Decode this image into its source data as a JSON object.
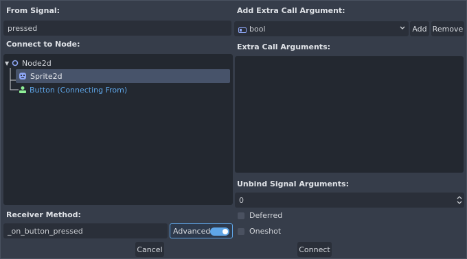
{
  "from_signal": {
    "label": "From Signal:",
    "value": "pressed"
  },
  "connect_to_node": {
    "label": "Connect to Node:",
    "tree": [
      {
        "label": "Node2d",
        "icon": "node2d-icon"
      },
      {
        "label": "Sprite2d",
        "icon": "sprite2d-icon",
        "selected": true
      },
      {
        "label": "Button (Connecting From)",
        "icon": "button-node-icon",
        "highlight": true
      }
    ]
  },
  "receiver_method": {
    "label": "Receiver Method:",
    "value": "_on_button_pressed"
  },
  "advanced": {
    "label": "Advanced",
    "enabled": true
  },
  "add_extra_arg": {
    "label": "Add Extra Call Argument:",
    "type_value": "bool",
    "add_label": "Add",
    "remove_label": "Remove"
  },
  "extra_args": {
    "label": "Extra Call Arguments:"
  },
  "unbind": {
    "label": "Unbind Signal Arguments:",
    "value": "0"
  },
  "deferred": {
    "label": "Deferred",
    "checked": false
  },
  "oneshot": {
    "label": "Oneshot",
    "checked": false
  },
  "footer": {
    "cancel_label": "Cancel",
    "connect_label": "Connect"
  },
  "colors": {
    "accent": "#5fa6e8",
    "node_icon": "#8da5f3",
    "button_icon": "#8eef97"
  }
}
